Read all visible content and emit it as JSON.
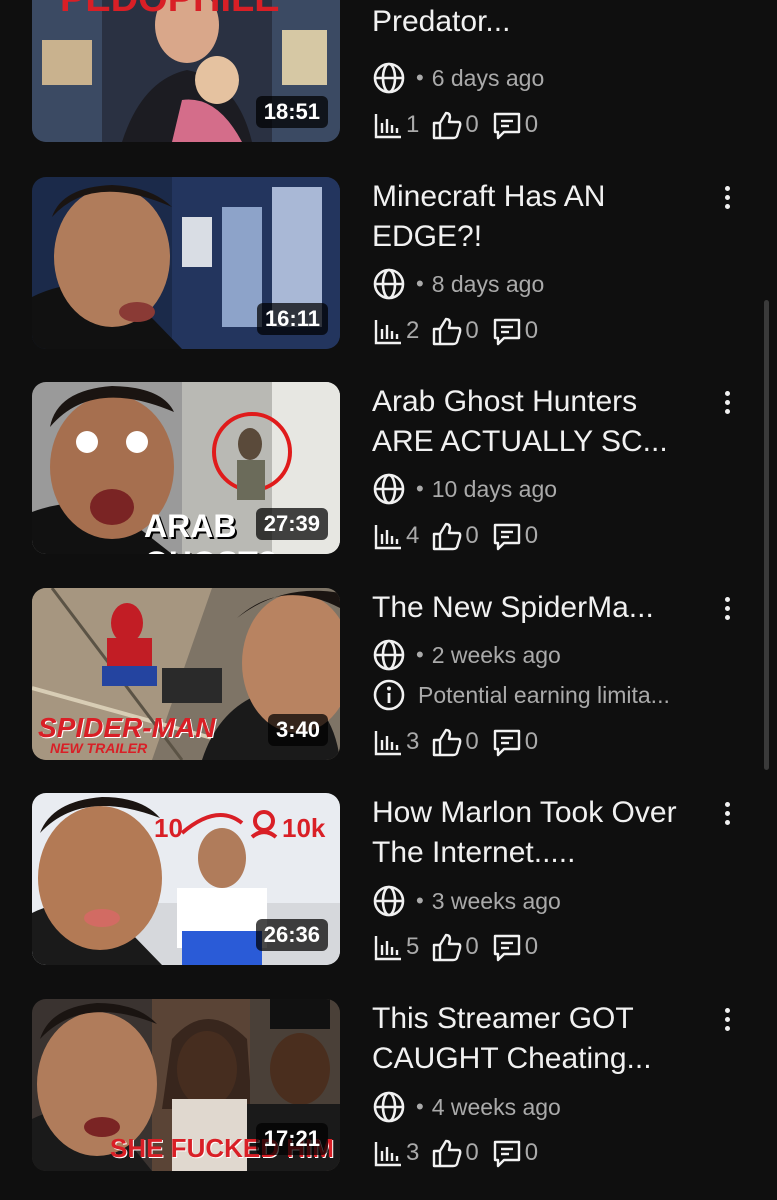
{
  "videos": [
    {
      "title": "The Mind of a Child Predator...",
      "duration": "18:51",
      "visibility_icon": "globe-icon",
      "age": "6 days ago",
      "views": "1",
      "likes": "0",
      "comments": "0",
      "thumb_text": "PEDOPHILE"
    },
    {
      "title": "Minecraft Has AN EDGE?!",
      "duration": "16:11",
      "visibility_icon": "globe-icon",
      "age": "8 days ago",
      "views": "2",
      "likes": "0",
      "comments": "0"
    },
    {
      "title": "Arab Ghost Hunters ARE ACTUALLY SC...",
      "duration": "27:39",
      "visibility_icon": "globe-icon",
      "age": "10 days ago",
      "views": "4",
      "likes": "0",
      "comments": "0",
      "thumb_text": "ARAB GHOST?"
    },
    {
      "title": "The New SpiderMa...",
      "duration": "3:40",
      "visibility_icon": "globe-icon",
      "age": "2 weeks ago",
      "warning": "Potential earning limita...",
      "views": "3",
      "likes": "0",
      "comments": "0",
      "thumb_text": "SPIDER-MAN",
      "thumb_subtext": "NEW TRAILER"
    },
    {
      "title": "How Marlon Took Over The Internet.....",
      "duration": "26:36",
      "visibility_icon": "globe-icon",
      "age": "3 weeks ago",
      "views": "5",
      "likes": "0",
      "comments": "0",
      "thumb_text_left": "10",
      "thumb_text_right": "10k"
    },
    {
      "title": "This Streamer GOT CAUGHT Cheating...",
      "duration": "17:21",
      "visibility_icon": "globe-icon",
      "age": "4 weeks ago",
      "views": "3",
      "likes": "0",
      "comments": "0",
      "thumb_text": "SHE FUCKED HIM"
    }
  ],
  "icons": {
    "views": "bar-chart-icon",
    "likes": "thumbs-up-icon",
    "comments": "comment-icon",
    "more": "more-vertical-icon",
    "warning": "info-icon"
  },
  "colors": {
    "background": "#0f0f0f",
    "primary_text": "#f1f1f1",
    "secondary_text": "#aaaaaa",
    "thumb_red": "#d91f26"
  }
}
